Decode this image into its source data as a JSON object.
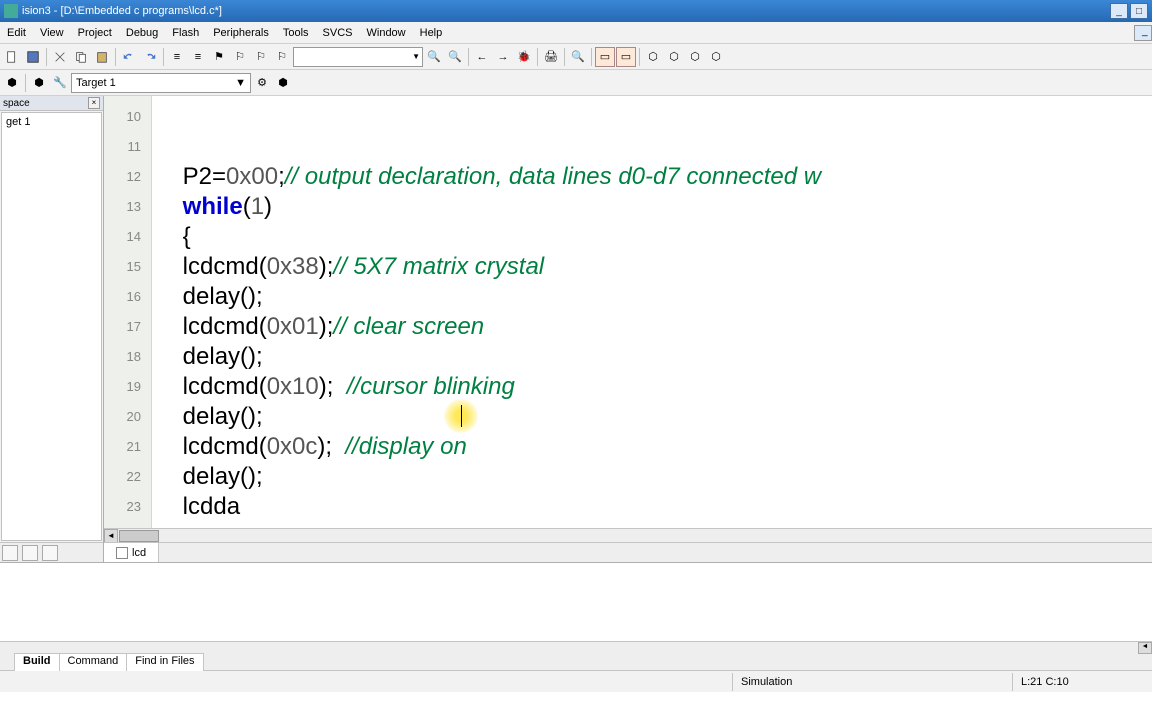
{
  "title": "ision3 - [D:\\Embedded c programs\\lcd.c*]",
  "menu": {
    "edit": "Edit",
    "view": "View",
    "project": "Project",
    "debug": "Debug",
    "flash": "Flash",
    "peripherals": "Peripherals",
    "tools": "Tools",
    "svcs": "SVCS",
    "window": "Window",
    "help": "Help"
  },
  "toolbar": {
    "search": ""
  },
  "target": {
    "label": "Target 1"
  },
  "workspace": {
    "title": "space",
    "node": "get 1"
  },
  "code": {
    "lines": [
      {
        "n": "10",
        "html": "P2=<span class='num'>0x00</span>;<span class='cmt'>// output declaration, data lines d0-d7 connected w</span>"
      },
      {
        "n": "11",
        "html": "<span class='kw'>while</span>(<span class='num'>1</span>)"
      },
      {
        "n": "12",
        "html": "{"
      },
      {
        "n": "13",
        "html": "lcdcmd(<span class='num'>0x38</span>);<span class='cmt'>// 5X7 matrix crystal</span>"
      },
      {
        "n": "14",
        "html": "delay();"
      },
      {
        "n": "15",
        "html": "lcdcmd(<span class='num'>0x01</span>);<span class='cmt'>// clear screen</span>"
      },
      {
        "n": "16",
        "html": "delay();"
      },
      {
        "n": "17",
        "html": "lcdcmd(<span class='num'>0x10</span>);  <span class='cmt'>//cursor blinking</span>"
      },
      {
        "n": "18",
        "html": "delay();"
      },
      {
        "n": "19",
        "html": "lcdcmd(<span class='num'>0x0c</span>);  <span class='cmt'>//display on</span>"
      },
      {
        "n": "20",
        "html": "delay();"
      },
      {
        "n": "21",
        "html": "lcdda"
      },
      {
        "n": "22",
        "html": ""
      },
      {
        "n": "23",
        "html": ""
      }
    ]
  },
  "filetab": {
    "name": "lcd"
  },
  "output_tabs": {
    "build": "Build",
    "command": "Command",
    "find": "Find in Files"
  },
  "status": {
    "sim": "Simulation",
    "cursor": "L:21 C:10"
  }
}
